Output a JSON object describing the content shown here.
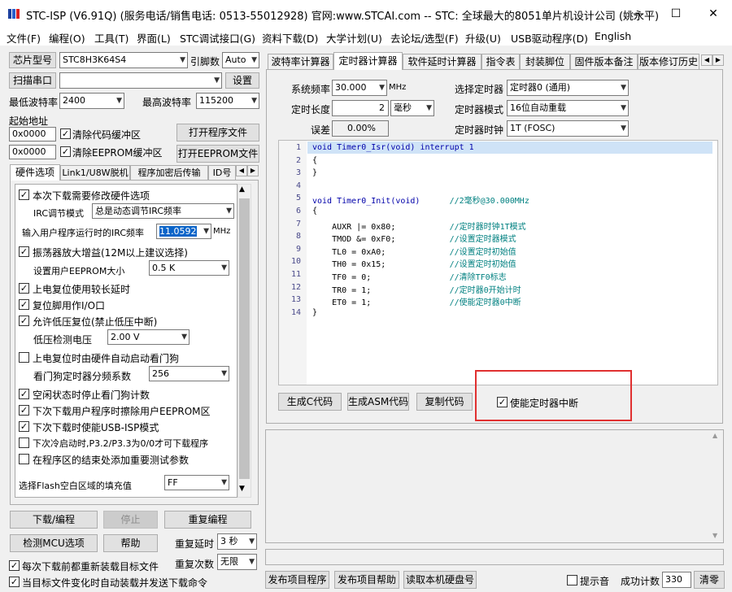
{
  "title": "STC-ISP (V6.91Q) (服务电话/销售电话: 0513-55012928) 官网:www.STCAI.com  -- STC: 全球最大的8051单片机设计公司 (姚永平)",
  "window": {
    "min": "—",
    "max": "☐",
    "close": "✕"
  },
  "menu": [
    "文件(F)",
    "编程(O)",
    "工具(T)",
    "界面(L)",
    "STC调试接口(G)",
    "资料下载(D)",
    "大学计划(U)",
    "去论坛/选型(F)",
    "升级(U)",
    "USB驱动程序(D)",
    "English"
  ],
  "left": {
    "chip_label": "芯片型号",
    "chip_value": "STC8H3K64S4",
    "pins_label": "引脚数",
    "pins_value": "Auto",
    "scan_button": "扫描串口",
    "port_value": "",
    "settings_button": "设置",
    "min_baud_label": "最低波特率",
    "min_baud": "2400",
    "max_baud_label": "最高波特率",
    "max_baud": "115200",
    "start_addr_label": "起始地址",
    "addr1": "0x0000",
    "clear_code": "清除代码缓冲区",
    "open_prog": "打开程序文件",
    "addr2": "0x0000",
    "clear_eeprom": "清除EEPROM缓冲区",
    "open_eeprom": "打开EEPROM文件",
    "tabs": [
      "硬件选项",
      "Link1/U8W脱机",
      "程序加密后传输",
      "ID号"
    ],
    "hw": {
      "modify": "本次下载需要修改硬件选项",
      "irc_mode_label": "IRC调节模式",
      "irc_mode": "总是动态调节IRC频率",
      "freq_label": "输入用户程序运行时的IRC频率",
      "freq_value": "11.0592",
      "freq_unit": "MHz",
      "osc_gain": "振荡器放大增益(12M以上建议选择)",
      "eeprom_size_label": "设置用户EEPROM大小",
      "eeprom_size": "0.5 K",
      "power_delay": "上电复位使用较长延时",
      "reset_io": "复位脚用作I/O口",
      "lvr": "允许低压复位(禁止低压中断)",
      "lvd_label": "低压检测电压",
      "lvd_value": "2.00 V",
      "wdt": "上电复位时由硬件自动启动看门狗",
      "wdt_div_label": "看门狗定时器分频系数",
      "wdt_div": "256",
      "idle_wdt": "空闲状态时停止看门狗计数",
      "erase_eeprom": "下次下载用户程序时擦除用户EEPROM区",
      "usb_isp": "下次下载时使能USB-ISP模式",
      "cold_boot": "下次冷启动时,P3.2/P3.3为0/0才可下载程序",
      "add_params": "在程序区的结束处添加重要测试参数",
      "fill_label": "选择Flash空白区域的填充值",
      "fill_value": "FF"
    },
    "download_button": "下载/编程",
    "stop_button": "停止",
    "reprogram_button": "重复编程",
    "check_mcu_button": "检测MCU选项",
    "help_button": "帮助",
    "repeat_delay_label": "重复延时",
    "repeat_delay": "3 秒",
    "repeat_count_label": "重复次数",
    "repeat_count": "无限",
    "reload_each": "每次下载前都重新装载目标文件",
    "auto_reload": "当目标文件变化时自动装载并发送下载命令"
  },
  "right": {
    "tabs": [
      "波特率计算器",
      "定时器计算器",
      "软件延时计算器",
      "指令表",
      "封装脚位",
      "固件版本备注",
      "版本修订历史"
    ],
    "sys_freq_label": "系统频率",
    "sys_freq": "30.000",
    "sys_freq_unit": "MHz",
    "timer_sel_label": "选择定时器",
    "timer_sel": "定时器0 (通用)",
    "length_label": "定时长度",
    "length_value": "2",
    "length_unit": "毫秒",
    "mode_label": "定时器模式",
    "mode_value": "16位自动重载",
    "error_label": "误差",
    "error_value": "0.00%",
    "clock_label": "定时器时钟",
    "clock_value": "1T  (FOSC)",
    "code": [
      {
        "n": "1",
        "t": "void Timer0_Isr(void) interrupt 1"
      },
      {
        "n": "2",
        "t": "{"
      },
      {
        "n": "3",
        "t": "}"
      },
      {
        "n": "4",
        "t": ""
      },
      {
        "n": "5",
        "t": "void Timer0_Init(void)      //2毫秒@30.000MHz"
      },
      {
        "n": "6",
        "t": "{"
      },
      {
        "n": "7",
        "t": "    AUXR |= 0x80;           //定时器时钟1T模式"
      },
      {
        "n": "8",
        "t": "    TMOD &= 0xF0;           //设置定时器模式"
      },
      {
        "n": "9",
        "t": "    TL0 = 0xA0;             //设置定时初始值"
      },
      {
        "n": "10",
        "t": "    TH0 = 0x15;             //设置定时初始值"
      },
      {
        "n": "11",
        "t": "    TF0 = 0;                //清除TF0标志"
      },
      {
        "n": "12",
        "t": "    TR0 = 1;                //定时器0开始计时"
      },
      {
        "n": "13",
        "t": "    ET0 = 1;                //使能定时器0中断"
      },
      {
        "n": "14",
        "t": "}"
      }
    ],
    "gen_c": "生成C代码",
    "gen_asm": "生成ASM代码",
    "copy_code": "复制代码",
    "enable_int": "使能定时器中断",
    "publish_prog": "发布项目程序",
    "publish_help": "发布项目帮助",
    "read_disk": "读取本机硬盘号",
    "sound_label": "提示音",
    "success_label": "成功计数",
    "success_count": "330",
    "clear_button": "清零"
  },
  "highlight_color": "#e03030"
}
